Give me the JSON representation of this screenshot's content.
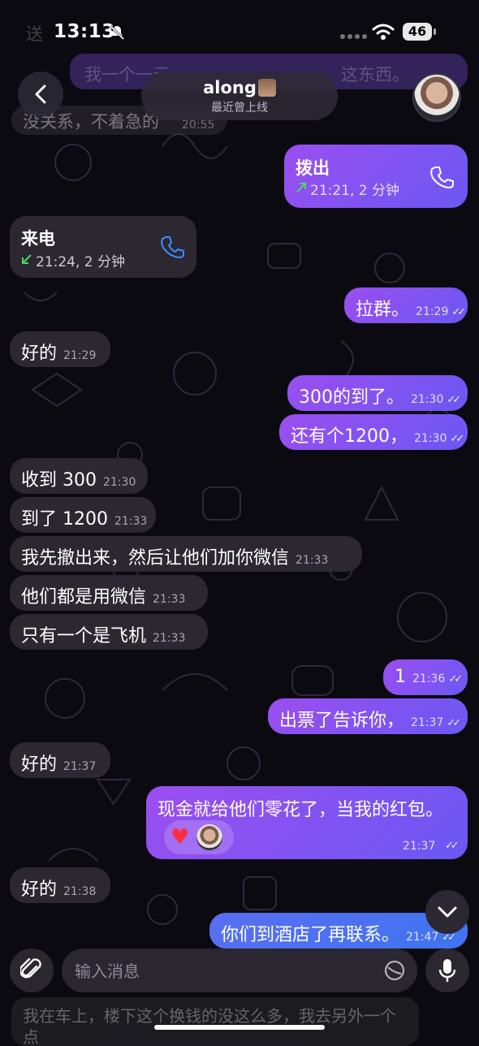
{
  "status": {
    "time": "13:13",
    "battery": "46"
  },
  "ghost": {
    "top_left": "送",
    "top_right": "我一个一元。。。",
    "top_right_end": "这东西。",
    "behind_left": "没关系，不着急的",
    "behind_time": "20:55"
  },
  "header": {
    "name": "along",
    "status": "最近曾上线"
  },
  "messages": {
    "call_out": {
      "title": "拨出",
      "detail": "21:21, 2 分钟"
    },
    "call_in": {
      "title": "来电",
      "detail": "21:24, 2 分钟"
    },
    "m1": {
      "text": "拉群。",
      "time": "21:29"
    },
    "m2": {
      "text": "好的",
      "time": "21:29"
    },
    "m3": {
      "text": "300的到了。",
      "time": "21:30"
    },
    "m4": {
      "text": "还有个1200，",
      "time": "21:30"
    },
    "m5": {
      "text": "收到 300",
      "time": "21:30"
    },
    "m6": {
      "text": "到了 1200",
      "time": "21:33"
    },
    "m7": {
      "text": "我先撤出来，然后让他们加你微信",
      "time": "21:33"
    },
    "m8": {
      "text": "他们都是用微信",
      "time": "21:33"
    },
    "m9": {
      "text": "只有一个是飞机",
      "time": "21:33"
    },
    "m10": {
      "text": "1",
      "time": "21:36"
    },
    "m11": {
      "text": "出票了告诉你，",
      "time": "21:37"
    },
    "m12": {
      "text": "好的",
      "time": "21:37"
    },
    "m13": {
      "text": "现金就给他们零花了，当我的红包。",
      "time": "21:37"
    },
    "m14": {
      "text": "好的",
      "time": "21:38"
    },
    "m15": {
      "text": "你们到酒店了再联系。",
      "time": "21:47"
    }
  },
  "input": {
    "placeholder": "输入消息"
  },
  "draft": "我在车上，楼下这个换钱的没这么多，我去另外一个点",
  "colors": {
    "outgoing_start": "#9b4ef0",
    "outgoing_end": "#6b58f3",
    "incoming": "#2c2731",
    "background": "#0b0a10",
    "call_out_arrow": "#4cd964",
    "call_in_arrow": "#4cd964",
    "call_icon_in": "#3d8bff",
    "heart": "#ff2f43"
  }
}
